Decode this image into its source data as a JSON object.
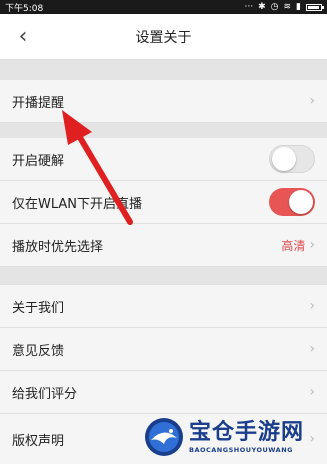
{
  "status_bar": {
    "time": "下午5:08",
    "icons": [
      "dots-icon",
      "bluetooth-icon",
      "alarm-icon",
      "wifi-icon",
      "signal-icon",
      "battery-icon"
    ],
    "battery_level": 0.8
  },
  "header": {
    "back_icon": "chevron-left-icon",
    "title": "设置关于"
  },
  "sections": [
    {
      "items": [
        {
          "label": "开播提醒",
          "chevron": "›"
        }
      ]
    },
    {
      "items": [
        {
          "label": "开启硬解",
          "toggle": false
        },
        {
          "label": "仅在WLAN下开启直播",
          "toggle": true
        },
        {
          "label": "播放时优先选择",
          "value": "高清",
          "chevron": "›"
        }
      ]
    },
    {
      "items": [
        {
          "label": "关于我们",
          "chevron": "›"
        },
        {
          "label": "意见反馈",
          "chevron": "›"
        },
        {
          "label": "给我们评分",
          "chevron": "›"
        },
        {
          "label": "版权声明",
          "chevron": "›"
        }
      ]
    }
  ],
  "colors": {
    "accent": "#e85555",
    "value_text": "#e0484c",
    "arrow": "#e02020"
  },
  "watermark": {
    "cn": "宝仓手游网",
    "en": "BAOCANGSHOUYOUWANG"
  }
}
